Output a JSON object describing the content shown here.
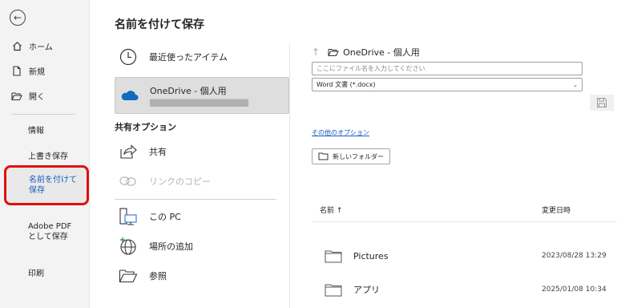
{
  "sidebar": {
    "back_icon": "back-arrow-icon",
    "items": [
      {
        "label": "ホーム",
        "icon": "home-icon"
      },
      {
        "label": "新規",
        "icon": "new-file-icon"
      },
      {
        "label": "開く",
        "icon": "open-folder-icon"
      }
    ],
    "text_items": [
      {
        "label": "情報"
      },
      {
        "label": "上書き保存"
      },
      {
        "label": "名前を付けて保存"
      },
      {
        "label": "Adobe PDF として保存"
      },
      {
        "label": "印刷"
      }
    ],
    "selected_label": "名前を付けて保存"
  },
  "page_title": "名前を付けて保存",
  "locations": {
    "recent": "最近使ったアイテム",
    "onedrive": "OneDrive - 個人用",
    "shared_options_label": "共有オプション",
    "share": "共有",
    "copy_link": "リンクのコピー",
    "this_pc": "この PC",
    "add_place": "場所の追加",
    "browse": "参照"
  },
  "save_panel": {
    "path_label": "OneDrive - 個人用",
    "filename_placeholder": "ここにファイル名を入力してください",
    "filetype": "Word 文書 (*.docx)",
    "more_options": "その他のオプション",
    "new_folder": "新しいフォルダー",
    "col_name": "名前 ↑",
    "col_modified": "変更日時",
    "files": [
      {
        "name": "Pictures",
        "modified": "2023/08/28 13:29"
      },
      {
        "name": "アプリ",
        "modified": "2025/01/08 10:34"
      }
    ]
  },
  "colors": {
    "accent_blue": "#185abd",
    "selection_outline": "#e01010",
    "sidebar_bg": "#f3f3f3"
  }
}
